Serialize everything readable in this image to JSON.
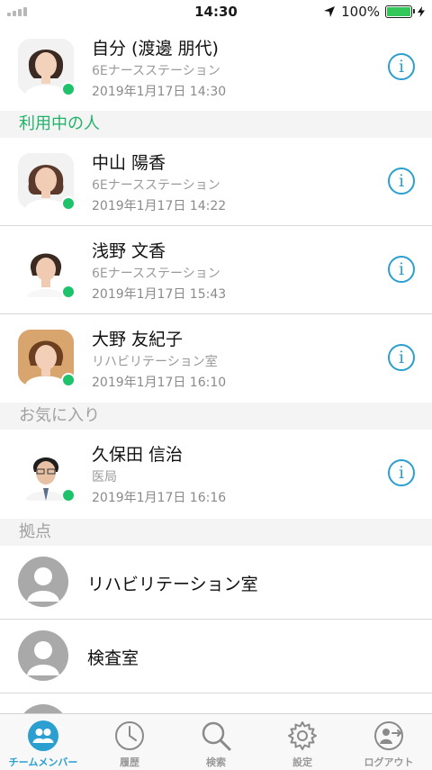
{
  "status_bar": {
    "time": "14:30",
    "battery_text": "100%",
    "battery_level": 1.0
  },
  "self": {
    "name": "自分 (渡邊 朋代)",
    "dept": "6Eナースステーション",
    "timestamp": "2019年1月17日 14:30",
    "online": true
  },
  "sections": {
    "in_use": "利用中の人",
    "favorites": "お気に入り",
    "bases": "拠点"
  },
  "in_use": [
    {
      "name": "中山 陽香",
      "dept": "6Eナースステーション",
      "timestamp": "2019年1月17日 14:22",
      "online": true
    },
    {
      "name": "浅野 文香",
      "dept": "6Eナースステーション",
      "timestamp": "2019年1月17日 15:43",
      "online": true
    },
    {
      "name": "大野 友紀子",
      "dept": "リハビリテーション室",
      "timestamp": "2019年1月17日 16:10",
      "online": true
    }
  ],
  "favorites": [
    {
      "name": "久保田 信治",
      "dept": "医局",
      "timestamp": "2019年1月17日 16:16",
      "online": true
    }
  ],
  "bases": [
    {
      "label": "リハビリテーション室"
    },
    {
      "label": "検査室"
    }
  ],
  "tabs": [
    {
      "label": "チームメンバー",
      "icon": "team-members-icon",
      "active": true
    },
    {
      "label": "履歴",
      "icon": "clock-icon",
      "active": false
    },
    {
      "label": "検索",
      "icon": "search-icon",
      "active": false
    },
    {
      "label": "設定",
      "icon": "gear-icon",
      "active": false
    },
    {
      "label": "ログアウト",
      "icon": "logout-icon",
      "active": false
    }
  ],
  "colors": {
    "accent": "#2a9fd0",
    "online": "#1ec26a",
    "section_accent": "#22b36a"
  }
}
